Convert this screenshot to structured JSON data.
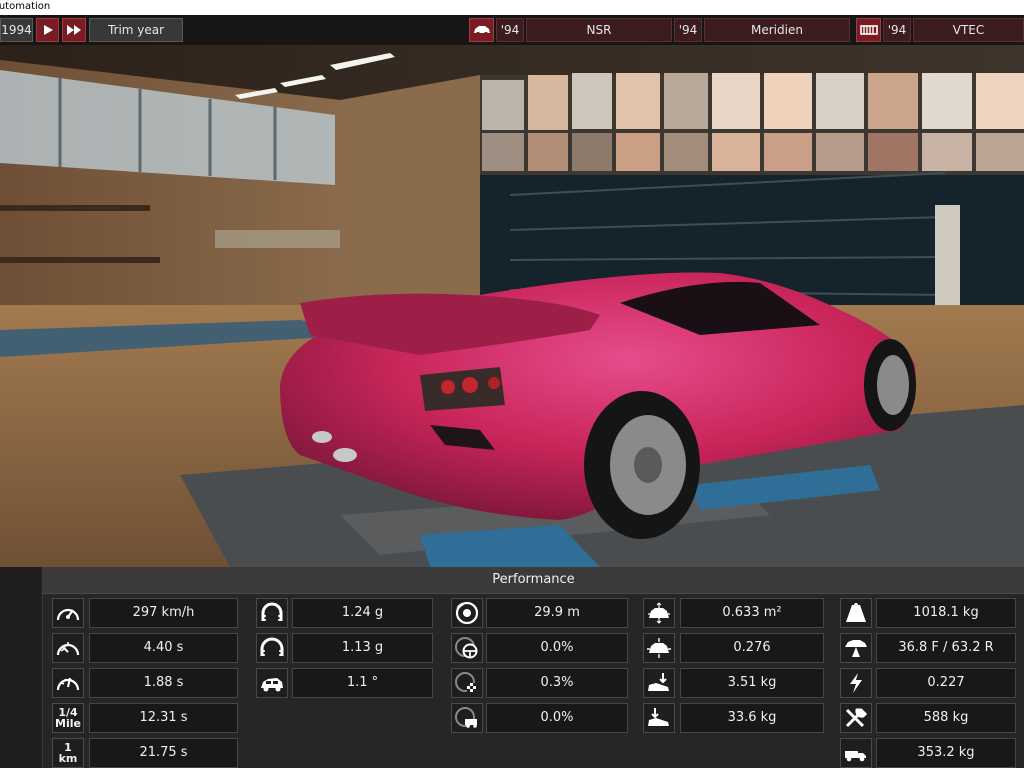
{
  "window": {
    "title": "Automation"
  },
  "topbar": {
    "year": "1994",
    "play_icon": "play-icon",
    "fast_forward_icon": "fast-forward-icon",
    "trim_year_label": "Trim year",
    "body_icon": "car-body-icon",
    "body_year": "'94",
    "body_name": "NSR",
    "model_year": "'94",
    "model_name": "Meridien",
    "engine_icon": "engine-icon",
    "engine_year": "'94",
    "engine_name": "VTEC"
  },
  "panel": {
    "title": "Performance",
    "stats": [
      {
        "icon": "speedometer-icon",
        "value": "297 km/h"
      },
      {
        "icon": "acceleration-gauge-icon",
        "value": "4.40 s"
      },
      {
        "icon": "gauge-icon",
        "value": "1.88 s"
      },
      {
        "icon": "quarter-mile-icon",
        "icon_text": [
          "1/4",
          "Mile"
        ],
        "value": "12.31 s"
      },
      {
        "icon": "one-km-icon",
        "icon_text": [
          "1",
          "km"
        ],
        "value": "21.75 s"
      },
      {
        "icon": "corner-grip-icon",
        "value": "1.24 g"
      },
      {
        "icon": "corner-grip-slow-icon",
        "value": "1.13 g"
      },
      {
        "icon": "body-roll-icon",
        "value": "1.1 °"
      },
      {
        "icon": "brake-disc-icon",
        "value": "29.9 m"
      },
      {
        "icon": "steering-brake-icon",
        "value": "0.0%"
      },
      {
        "icon": "brake-fade-icon",
        "value": "0.3%"
      },
      {
        "icon": "brake-tow-icon",
        "value": "0.0%"
      },
      {
        "icon": "frontal-area-icon",
        "value": "0.633 m²"
      },
      {
        "icon": "drag-coefficient-icon",
        "value": "0.276"
      },
      {
        "icon": "downforce-front-icon",
        "value": "3.51 kg"
      },
      {
        "icon": "downforce-rear-icon",
        "value": "33.6 kg"
      },
      {
        "icon": "weight-icon",
        "value": "1018.1 kg"
      },
      {
        "icon": "weight-distribution-icon",
        "value": "36.8 F / 63.2 R"
      },
      {
        "icon": "power-to-weight-icon",
        "value": "0.227"
      },
      {
        "icon": "tools-payload-icon",
        "value": "588 kg"
      },
      {
        "icon": "tow-truck-icon",
        "value": "353.2 kg"
      }
    ]
  }
}
